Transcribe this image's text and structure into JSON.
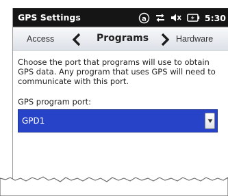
{
  "statusbar": {
    "title": "GPS Settings",
    "time": "5:30",
    "icons": [
      "keyboard-a-icon",
      "sync-arrows-icon",
      "volume-muted-icon",
      "battery-charging-icon"
    ]
  },
  "tabs": {
    "previous": "Access",
    "current": "Programs",
    "next": "Hardware"
  },
  "content": {
    "description": "Choose the port that programs will use to obtain GPS data. Any program that uses GPS will need to communicate with this port.",
    "port_label": "GPS program port:",
    "port_value": "GPD1"
  },
  "colors": {
    "statusbar_bg": "#151515",
    "selection_bg": "#2744c8"
  }
}
